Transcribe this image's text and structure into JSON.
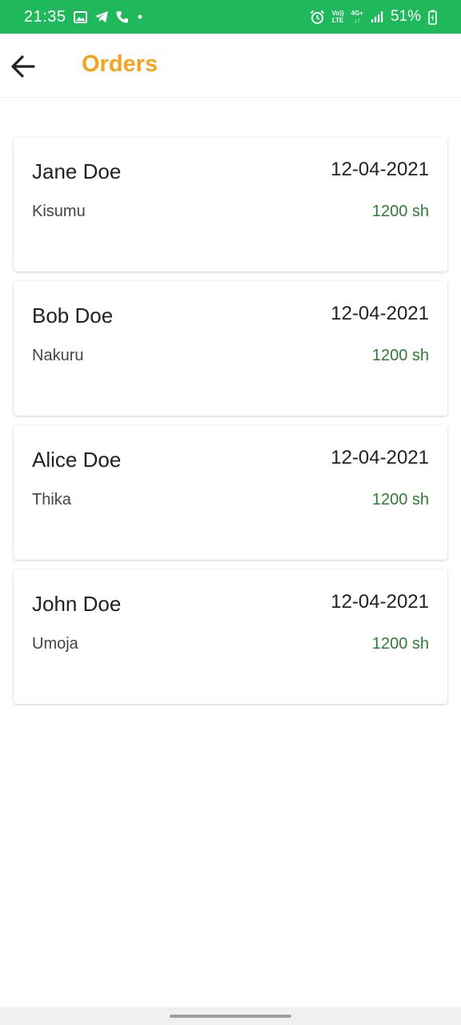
{
  "status_bar": {
    "time": "21:35",
    "battery": "51%",
    "network_top": "Vo))",
    "network_bottom": "LTE",
    "data_type": "4G+",
    "icons": [
      "image-icon",
      "telegram-icon",
      "phone-icon",
      "dot-icon",
      "alarm-icon",
      "signal-icon",
      "battery-charging-icon"
    ]
  },
  "header": {
    "title": "Orders",
    "back_icon": "arrow-back-icon",
    "title_color": "#f5a21e"
  },
  "orders": [
    {
      "name": "Jane Doe",
      "date": "12-04-2021",
      "location": "Kisumu",
      "price": "1200 sh"
    },
    {
      "name": "Bob Doe",
      "date": "12-04-2021",
      "location": "Nakuru",
      "price": "1200 sh"
    },
    {
      "name": "Alice Doe",
      "date": "12-04-2021",
      "location": "Thika",
      "price": "1200 sh"
    },
    {
      "name": "John Doe",
      "date": "12-04-2021",
      "location": "Umoja",
      "price": "1200 sh"
    }
  ],
  "colors": {
    "status_bar": "#1fb85a",
    "price": "#2e7d32",
    "accent": "#f5a21e"
  }
}
